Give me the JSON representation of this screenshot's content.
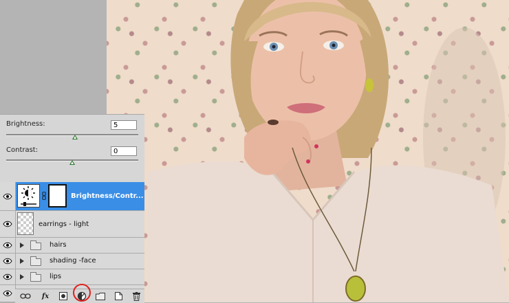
{
  "adjustments": {
    "brightness_label": "Brightness:",
    "brightness_value": "5",
    "brightness_level_fraction": 0.52,
    "contrast_label": "Contrast:",
    "contrast_value": "0",
    "contrast_level_fraction": 0.5
  },
  "layers": [
    {
      "name": "Brightness/Contr...",
      "type": "adjustment",
      "selected": true
    },
    {
      "name": "earrings - light",
      "type": "pixel",
      "selected": false
    },
    {
      "name": "hairs",
      "type": "group",
      "selected": false
    },
    {
      "name": "shading -face",
      "type": "group",
      "selected": false
    },
    {
      "name": "lips",
      "type": "group",
      "selected": false
    }
  ],
  "toolbar": {
    "fx_label": "fx",
    "icons": [
      "link-layers-icon",
      "layer-style-icon",
      "add-mask-icon",
      "new-adjustment-layer-icon",
      "new-group-icon",
      "new-layer-icon",
      "delete-layer-icon"
    ]
  },
  "colors": {
    "selected_layer": "#3a8ee6",
    "panel_bg": "#d6d6d6",
    "highlight_ring": "#e02020",
    "slider_thumb": "#2e7a2e"
  }
}
